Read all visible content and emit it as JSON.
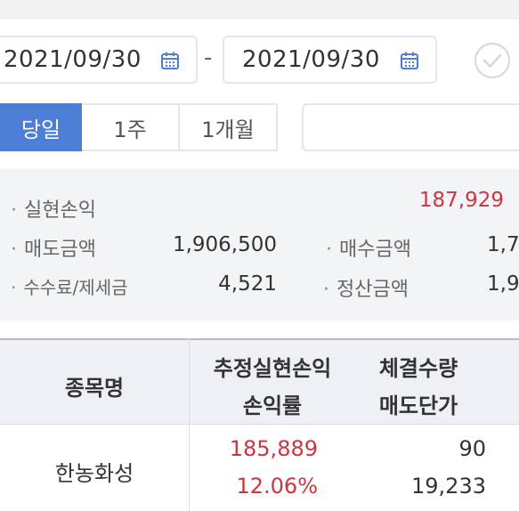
{
  "date_range": {
    "from": "2021/09/30",
    "separator": "-",
    "to": "2021/09/30",
    "calendar_icon": "calendar-icon",
    "confirm_icon": "check-circle-icon"
  },
  "period_tabs": [
    {
      "label": "당일",
      "active": true
    },
    {
      "label": "1주",
      "active": false
    },
    {
      "label": "1개월",
      "active": false
    }
  ],
  "summary": {
    "realized_pl_label": "실현손익",
    "realized_pl_value": "187,929",
    "sell_amount_label": "매도금액",
    "sell_amount_value": "1,906,500",
    "buy_amount_label": "매수금액",
    "buy_amount_value": "1,7",
    "fee_tax_label": "수수료/제세금",
    "fee_tax_value": "4,521",
    "settlement_label": "정산금액",
    "settlement_value": "1,9",
    "bullet": "·"
  },
  "table": {
    "headers": {
      "name": "종목명",
      "est_pl": "추정실현손익",
      "pl_rate": "손익률",
      "exec_qty": "체결수량",
      "sell_price": "매도단가"
    },
    "rows": [
      {
        "name": "한농화성",
        "est_pl": "185,889",
        "pl_rate": "12.06%",
        "exec_qty": "90",
        "sell_price": "19,233"
      }
    ]
  },
  "colors": {
    "accent": "#4d7fd6",
    "profit": "#d0343f",
    "panel": "#f3f4f8"
  }
}
